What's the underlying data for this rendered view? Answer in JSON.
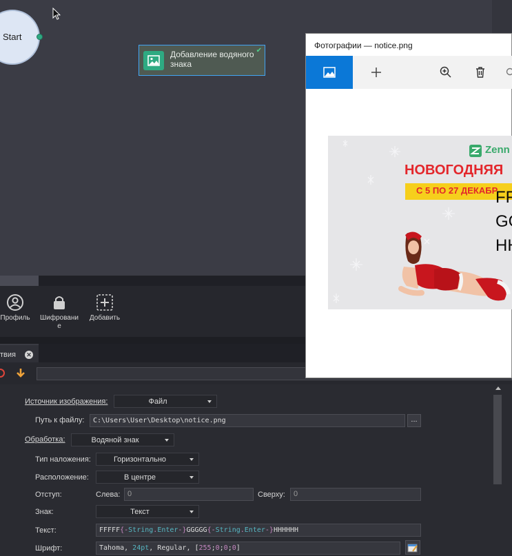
{
  "canvas": {
    "start_node": {
      "label": "Start"
    },
    "action_node": {
      "label": "Добавление водяного знака"
    }
  },
  "toolbox": {
    "items": [
      {
        "label": "Профиль",
        "icon": "user-circle-icon"
      },
      {
        "label": "Шифрование",
        "icon": "lock-icon"
      },
      {
        "label": "Добавить",
        "icon": "plus-box-icon"
      }
    ]
  },
  "props_tab": {
    "label": "твия"
  },
  "properties": {
    "source": {
      "label": "Источник изображения:",
      "value": "Файл"
    },
    "file_path": {
      "label": "Путь к файлу:",
      "value": "C:\\Users\\User\\Desktop\\notice.png",
      "browse": "..."
    },
    "processing": {
      "label": "Обработка:",
      "value": "Водяной знак"
    },
    "overlay_type": {
      "label": "Тип наложения:",
      "value": "Горизонтально"
    },
    "position": {
      "label": "Расположение:",
      "value": "В центре"
    },
    "offset": {
      "label": "Отступ:",
      "left_label": "Слева:",
      "left_value": "0",
      "top_label": "Сверху:",
      "top_value": "0"
    },
    "mark": {
      "label": "Знак:",
      "value": "Текст"
    },
    "text": {
      "label": "Текст:",
      "parts": {
        "p1": "FFFFF",
        "b1": "{-",
        "n1": "String",
        "d1": ".",
        "m1": "Enter",
        "e1": "-}",
        "p2": "GGGGG",
        "b2": "{-",
        "n2": "String",
        "d2": ".",
        "m2": "Enter",
        "e2": "-}",
        "p3": "HHHHHH"
      }
    },
    "font": {
      "label": "Шрифт:",
      "parts": {
        "name": "Tahoma, ",
        "size": "24pt",
        "rest": ", Regular, [",
        "c1": "255",
        "s1": ";",
        "c2": "0",
        "s2": ";",
        "c3": "0",
        "s3": ";",
        "c4": "0",
        "end": "]"
      }
    }
  },
  "photos_window": {
    "title": "Фотографии — notice.png",
    "banner": {
      "logo": "Zenn",
      "heading": "НОВОГОДНЯЯ",
      "date": "С 5 ПО 27 ДЕКАБР",
      "watermark_lines": [
        "FFFFF",
        "GGGGG",
        "HHHHH"
      ]
    }
  },
  "colors": {
    "accent_blue": "#0b78d7",
    "node_border": "#42a5f5",
    "node_icon": "#2eaa82",
    "banner_red": "#e3262b",
    "banner_yellow": "#f6cf1c"
  }
}
